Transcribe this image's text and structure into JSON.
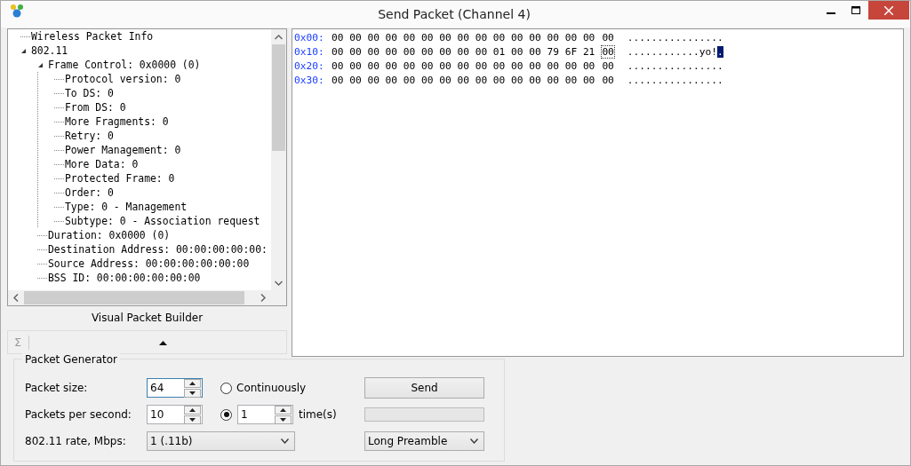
{
  "window": {
    "title": "Send Packet (Channel 4)"
  },
  "tree": [
    {
      "label": "Wireless Packet Info"
    },
    {
      "label": "802.11",
      "expanded": true,
      "children": [
        {
          "label": "Frame Control: 0x0000 (0)",
          "expanded": true,
          "children": [
            {
              "label": "Protocol version: 0"
            },
            {
              "label": "To DS: 0"
            },
            {
              "label": "From DS: 0"
            },
            {
              "label": "More Fragments: 0"
            },
            {
              "label": "Retry: 0"
            },
            {
              "label": "Power Management: 0"
            },
            {
              "label": "More Data: 0"
            },
            {
              "label": "Protected Frame: 0"
            },
            {
              "label": "Order: 0"
            },
            {
              "label": "Type: 0 - Management"
            },
            {
              "label": "Subtype: 0 - Association request"
            }
          ]
        },
        {
          "label": "Duration: 0x0000 (0)"
        },
        {
          "label": "Destination Address: 00:00:00:00:00:"
        },
        {
          "label": "Source Address: 00:00:00:00:00:00"
        },
        {
          "label": "BSS ID: 00:00:00:00:00:00"
        }
      ]
    }
  ],
  "builder": {
    "title": "Visual Packet Builder",
    "symbol": "Σ"
  },
  "hex_rows": [
    {
      "offset": "0x00:",
      "bytes": "00 00 00 00 00 00 00 00 00 00 00 00 00 00 00",
      "last_byte": "00",
      "text": "...............",
      "last_char": ".",
      "cursor": false
    },
    {
      "offset": "0x10:",
      "bytes": "00 00 00 00 00 00 00 00 00 01 00 00 79 6F 21",
      "last_byte": "00",
      "text": "............yo!",
      "last_char": ".",
      "cursor": true
    },
    {
      "offset": "0x20:",
      "bytes": "00 00 00 00 00 00 00 00 00 00 00 00 00 00 00",
      "last_byte": "00",
      "text": "...............",
      "last_char": ".",
      "cursor": false
    },
    {
      "offset": "0x30:",
      "bytes": "00 00 00 00 00 00 00 00 00 00 00 00 00 00 00",
      "last_byte": "00",
      "text": "...............",
      "last_char": ".",
      "cursor": false
    }
  ],
  "generator": {
    "title": "Packet Generator",
    "packet_size": {
      "label": "Packet size:",
      "value": "64",
      "focused": true
    },
    "packets_per_second": {
      "label": "Packets per second:",
      "value": "10",
      "focused": false
    },
    "rate": {
      "label": "802.11 rate, Mbps:",
      "value": "1 (.11b)"
    },
    "modes": [
      {
        "label": "Continuously",
        "selected": false
      },
      {
        "value": "1",
        "suffix": "time(s)",
        "selected": true
      }
    ],
    "send": {
      "label": "Send"
    },
    "progress": {
      "level": 0
    },
    "preamble": {
      "value": "Long Preamble"
    }
  }
}
